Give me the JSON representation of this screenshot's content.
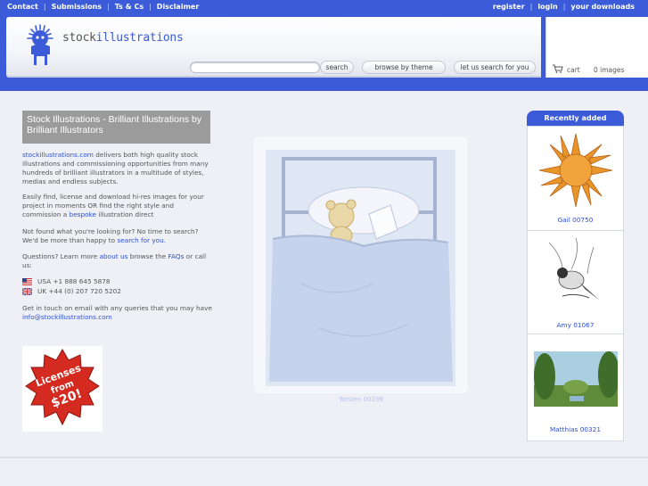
{
  "topnav": {
    "items": [
      "Contact",
      "Submissions",
      "Ts & Cs",
      "Disclaimer"
    ],
    "user_items": [
      "register",
      "login",
      "your downloads"
    ]
  },
  "logo": {
    "prefix": "stock",
    "suffix": "illustrations"
  },
  "search": {
    "value": "",
    "button": "search"
  },
  "buttons": {
    "browse": "browse by theme",
    "letus": "let us search for you"
  },
  "cart": {
    "label": "cart",
    "count": "0 images"
  },
  "intro": {
    "title": "Stock Illustrations - Brilliant Illustrations by Brilliant Illustrators",
    "p1_link": "stockillustrations.com",
    "p1_text": " delivers both high quality stock illustrations and commissioning opportunities from many hundreds of brilliant illustrators in a multitude of styles, medias and endless subjects.",
    "p2_text": "Easily find, license and download hi-res images for your project in moments OR find the right style and commission a ",
    "p2_link": "bespoke",
    "p2_end": " illustration direct",
    "p3_text": "Not found what you're looking for? No time to search? We'd be more than happy to ",
    "p3_link": "search for you.",
    "p4_a": "Questions? Learn more ",
    "p4_link1": "about us",
    "p4_b": " browse the ",
    "p4_link2": "FAQs",
    "p4_c": " or call us:",
    "phone_us": "USA +1 888 645 5878",
    "phone_uk": "UK +44 (0) 207 720 5202",
    "p5_text": "Get in touch on email with any queries that you may have ",
    "p5_link": "info@stockillustrations.com"
  },
  "badge": {
    "line1": "Licenses",
    "line2": "from",
    "line3": "$20!"
  },
  "featured": {
    "caption": "Torsten 00239"
  },
  "recent": {
    "heading": "Recently added",
    "items": [
      {
        "caption": "Gail 00750",
        "icon": "sun-illustration"
      },
      {
        "caption": "Amy 01067",
        "icon": "bird-illustration"
      },
      {
        "caption": "Matthias 00321",
        "icon": "landscape-illustration"
      }
    ]
  },
  "colors": {
    "brand_blue": "#3b5bd8",
    "link": "#2c4fd6",
    "title_bg": "#9b9b9b"
  }
}
